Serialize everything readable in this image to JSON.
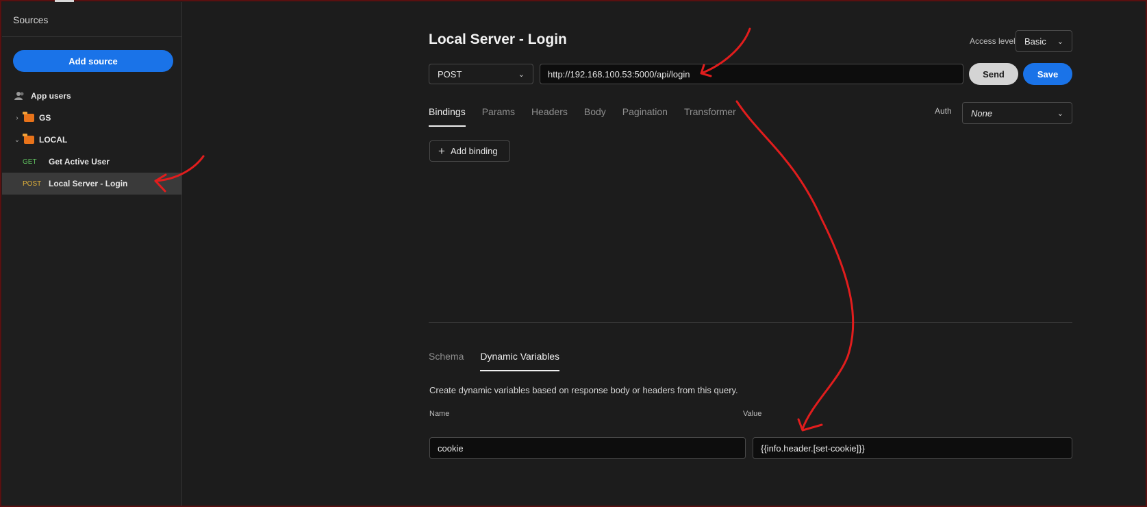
{
  "sidebar": {
    "header": "Sources",
    "add_source_label": "Add source",
    "items": [
      {
        "label": "App users"
      },
      {
        "label": "GS",
        "chevron": "›"
      },
      {
        "label": "LOCAL",
        "chevron": "⌄"
      },
      {
        "method": "GET",
        "label": "Get Active User"
      },
      {
        "method": "POST",
        "label": "Local Server - Login"
      }
    ]
  },
  "query": {
    "title": "Local Server - Login",
    "access_level_label": "Access level",
    "access_level_value": "Basic",
    "method": "POST",
    "url": "http://192.168.100.53:5000/api/login",
    "send_label": "Send",
    "save_label": "Save"
  },
  "tabs": [
    "Bindings",
    "Params",
    "Headers",
    "Body",
    "Pagination",
    "Transformer"
  ],
  "auth": {
    "label": "Auth",
    "value": "None"
  },
  "add_binding_label": "Add binding",
  "bottom_tabs": [
    "Schema",
    "Dynamic Variables"
  ],
  "dynamic_variables": {
    "description": "Create dynamic variables based on response body or headers from this query.",
    "name_label": "Name",
    "value_label": "Value",
    "name_value": "cookie",
    "value_value": "{{info.header.[set-cookie]}}"
  },
  "colors": {
    "accent": "#1a73e8",
    "annotation": "#e11d1d",
    "get": "#5fbf5f",
    "post": "#e0b13a"
  }
}
